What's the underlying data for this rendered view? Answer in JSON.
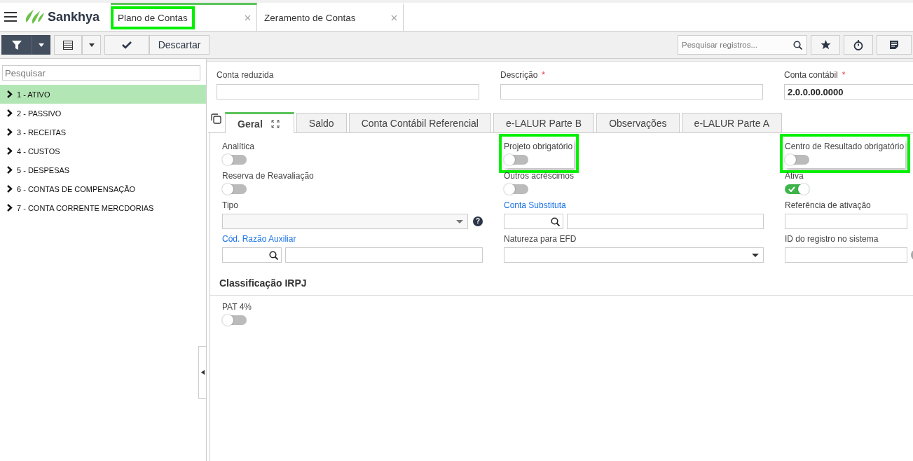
{
  "app": {
    "logo": "Sankhya"
  },
  "tabs": [
    {
      "label": "Plano de Contas",
      "selected": true,
      "highlighted": true
    },
    {
      "label": "Zeramento de Contas",
      "selected": false,
      "highlighted": false
    }
  ],
  "toolbar": {
    "discard_button": "Descartar",
    "search": {
      "placeholder": "Pesquisar registros..."
    }
  },
  "sidebar": {
    "search": {
      "placeholder": "Pesquisar"
    },
    "items": [
      {
        "label": "1 - ATIVO",
        "selected": true
      },
      {
        "label": "2 - PASSIVO",
        "selected": false
      },
      {
        "label": "3 - RECEITAS",
        "selected": false
      },
      {
        "label": "4 - CUSTOS",
        "selected": false
      },
      {
        "label": "5 - DESPESAS",
        "selected": false
      },
      {
        "label": "6 - CONTAS DE COMPENSAÇÃO",
        "selected": false
      },
      {
        "label": "7 - CONTA CORRENTE MERCDORIAS",
        "selected": false
      }
    ]
  },
  "header_fields": [
    {
      "label": "Conta reduzida"
    },
    {
      "label": "Descrição",
      "required_mark": "*"
    },
    {
      "label": "Conta contábil",
      "required_mark": "*",
      "value": "2.0.0.00.0000"
    }
  ],
  "form_tabs": [
    {
      "label": "Geral",
      "selected": true
    },
    {
      "label": "Saldo",
      "selected": false
    },
    {
      "label": "Conta Contábil Referencial",
      "selected": false
    },
    {
      "label": "e-LALUR Parte B",
      "selected": false
    },
    {
      "label": "Observações",
      "selected": false
    },
    {
      "label": "e-LALUR Parte A",
      "selected": false
    }
  ],
  "fields": [
    {
      "kind": "switch",
      "label": "Analítica",
      "on": false,
      "highlighted": false
    },
    {
      "kind": "switch",
      "label": "Projeto obrigatório",
      "on": false,
      "highlighted": true
    },
    {
      "kind": "switch",
      "label": "Centro de Resultado obrigatório",
      "on": false,
      "highlighted": true
    },
    {
      "kind": "switch",
      "label": "Reserva de Reavaliação",
      "on": false,
      "highlighted": false
    },
    {
      "kind": "switch",
      "label": "Outros acréscimos",
      "on": false,
      "highlighted": false
    },
    {
      "kind": "switch",
      "label": "Ativa",
      "on": true,
      "highlighted": false
    },
    {
      "kind": "select",
      "label": "Tipo",
      "link": false,
      "disabled": true,
      "help_icon": "?"
    },
    {
      "kind": "lookup",
      "label": "Conta Substituta",
      "link": true
    },
    {
      "kind": "text",
      "label": "Referência de ativação",
      "link": false
    },
    {
      "kind": "lookup",
      "label": "Cód. Razão Auxiliar",
      "link": true
    },
    {
      "kind": "select",
      "label": "Natureza para EFD",
      "link": false,
      "disabled": false
    },
    {
      "kind": "text",
      "label": "ID do registro no sistema",
      "link": false,
      "extra_button": true
    }
  ],
  "section": {
    "title": "Classificação IRPJ",
    "fields": [
      {
        "kind": "switch",
        "label": "PAT 4%",
        "on": false,
        "highlighted": false
      }
    ]
  }
}
